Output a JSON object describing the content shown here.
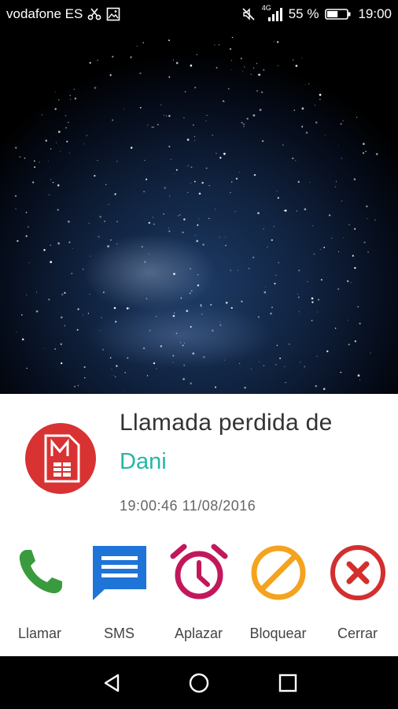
{
  "status_bar": {
    "carrier": "vodafone ES",
    "network_type": "4G",
    "battery_percent": "55 %",
    "battery_level": 0.55,
    "time": "19:00",
    "icons": [
      "scissors-icon",
      "image-icon",
      "mute-icon",
      "signal-icon",
      "battery-icon"
    ]
  },
  "notification": {
    "title": "Llamada perdida de",
    "contact_name": "Dani",
    "datetime": "19:00:46  11/08/2016",
    "app_logo_icon": "sim-card-icon",
    "colors": {
      "logo_bg": "#d83232",
      "contact": "#25b7a3"
    }
  },
  "actions": [
    {
      "label": "Llamar",
      "icon": "phone-icon",
      "color": "#3a9a3e"
    },
    {
      "label": "SMS",
      "icon": "message-icon",
      "color": "#1f74d8"
    },
    {
      "label": "Aplazar",
      "icon": "alarm-icon",
      "color": "#c2185b"
    },
    {
      "label": "Bloquear",
      "icon": "block-icon",
      "color": "#f4a31f"
    },
    {
      "label": "Cerrar",
      "icon": "close-icon",
      "color": "#d32f2f"
    }
  ],
  "nav_bar": {
    "icons": [
      "back-icon",
      "home-icon",
      "recents-icon"
    ]
  }
}
